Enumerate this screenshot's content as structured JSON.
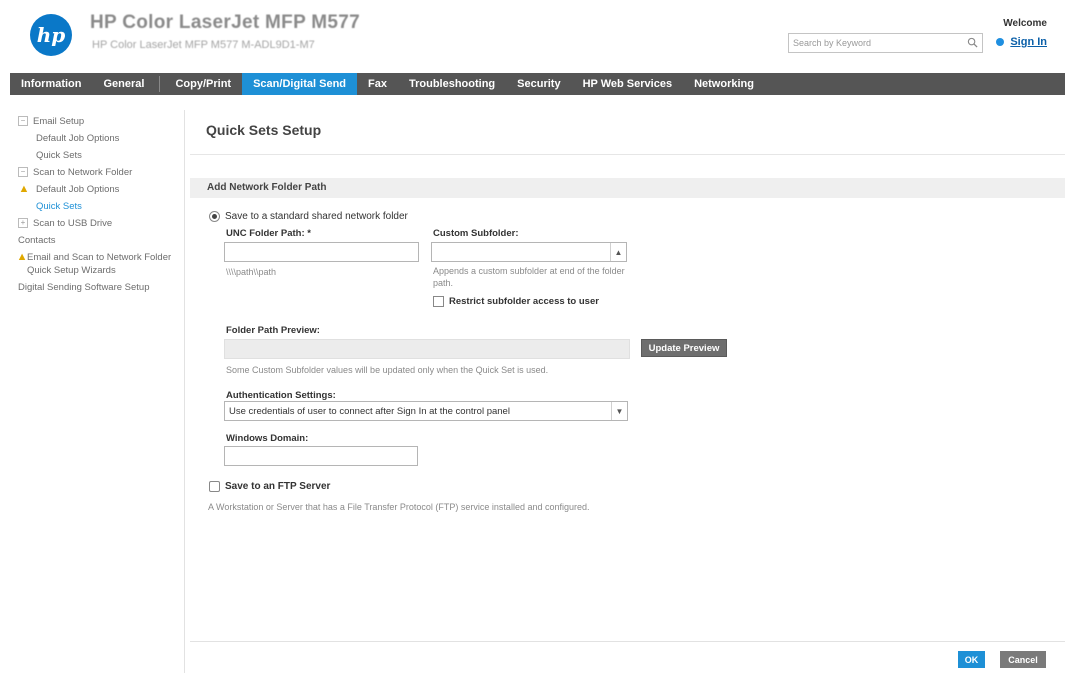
{
  "header": {
    "logo_text": "hp",
    "product_name": "HP Color LaserJet MFP M577",
    "product_sub": "HP Color LaserJet MFP M577    M-ADL9D1-M7",
    "search_placeholder": "Search by Keyword",
    "welcome": "Welcome",
    "sign_in": "Sign In"
  },
  "nav": {
    "tabs": [
      {
        "label": "Information"
      },
      {
        "label": "General"
      },
      {
        "label": "Copy/Print"
      },
      {
        "label": "Scan/Digital Send"
      },
      {
        "label": "Fax"
      },
      {
        "label": "Troubleshooting"
      },
      {
        "label": "Security"
      },
      {
        "label": "HP Web Services"
      },
      {
        "label": "Networking"
      }
    ]
  },
  "sidebar": {
    "items": [
      {
        "label": "Email Setup"
      },
      {
        "label": "Default Job Options"
      },
      {
        "label": "Quick Sets"
      },
      {
        "label": "Scan to Network Folder"
      },
      {
        "label": "Default Job Options"
      },
      {
        "label": "Quick Sets"
      },
      {
        "label": "Scan to USB Drive"
      },
      {
        "label": "Contacts"
      },
      {
        "label": "Email and Scan to Network Folder Quick Setup Wizards"
      },
      {
        "label": "Digital Sending Software Setup"
      }
    ]
  },
  "main": {
    "title": "Quick Sets Setup",
    "section_title": "Add Network Folder Path",
    "radio_standard": "Save to a standard shared network folder",
    "unc_label": "UNC Folder Path: *",
    "unc_value": "",
    "unc_hint": "\\\\\\\\path\\\\path",
    "custom_subfolder_label": "Custom Subfolder:",
    "custom_subfolder_hint": "Appends a custom subfolder at end of the folder path.",
    "restrict_label": "Restrict subfolder access to user",
    "preview_label": "Folder Path Preview:",
    "preview_value": "",
    "update_preview_button": "Update Preview",
    "preview_hint": "Some Custom Subfolder values will be updated only when the Quick Set is used.",
    "auth_label": "Authentication Settings:",
    "auth_selected": "Use credentials of user to connect after Sign In at the control panel",
    "windows_domain_label": "Windows Domain:",
    "windows_domain_value": "",
    "ftp_label": "Save to an FTP Server",
    "ftp_hint": "A Workstation or Server that has a File Transfer Protocol (FTP) service installed and configured.",
    "ok_button": "OK",
    "cancel_button": "Cancel"
  },
  "colors": {
    "accent": "#1e90d6",
    "nav_bg": "#555555",
    "warning": "#e0a800"
  }
}
